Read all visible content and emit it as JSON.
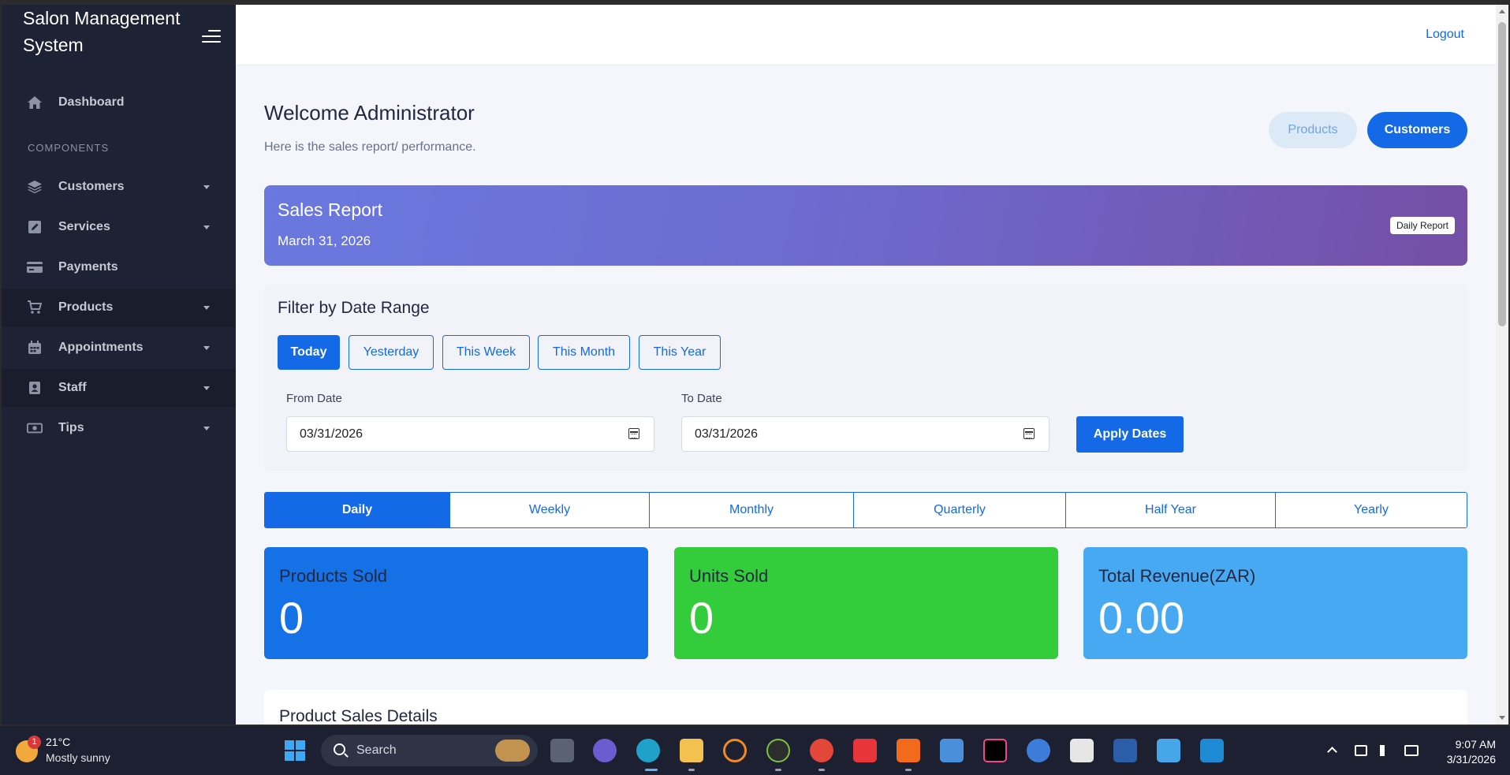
{
  "app": {
    "brand": "Salon Management System",
    "logout_label": "Logout"
  },
  "sidebar": {
    "section_label": "COMPONENTS",
    "items": [
      {
        "label": "Dashboard",
        "icon": "home-icon",
        "has_caret": false
      },
      {
        "label": "Customers",
        "icon": "layers-icon",
        "has_caret": true
      },
      {
        "label": "Services",
        "icon": "edit-icon",
        "has_caret": true
      },
      {
        "label": "Payments",
        "icon": "credit-card-icon",
        "has_caret": false
      },
      {
        "label": "Products",
        "icon": "cart-icon",
        "has_caret": true,
        "active": true
      },
      {
        "label": "Appointments",
        "icon": "calendar-icon",
        "has_caret": true
      },
      {
        "label": "Staff",
        "icon": "id-card-icon",
        "has_caret": true,
        "active": true
      },
      {
        "label": "Tips",
        "icon": "money-icon",
        "has_caret": true
      }
    ]
  },
  "header": {
    "title": "Welcome Administrator",
    "subtitle": "Here is the sales report/ performance.",
    "products_button": "Products",
    "customers_button": "Customers"
  },
  "banner": {
    "title": "Sales Report",
    "date": "March 31, 2026",
    "badge": "Daily Report"
  },
  "filter": {
    "title": "Filter by Date Range",
    "ranges": [
      {
        "label": "Today",
        "active": true
      },
      {
        "label": "Yesterday",
        "active": false
      },
      {
        "label": "This Week",
        "active": false
      },
      {
        "label": "This Month",
        "active": false
      },
      {
        "label": "This Year",
        "active": false
      }
    ],
    "from_label": "From Date",
    "from_value": "03/31/2026",
    "to_label": "To Date",
    "to_value": "03/31/2026",
    "apply_label": "Apply Dates"
  },
  "periods": [
    {
      "label": "Daily",
      "active": true
    },
    {
      "label": "Weekly",
      "active": false
    },
    {
      "label": "Monthly",
      "active": false
    },
    {
      "label": "Quarterly",
      "active": false
    },
    {
      "label": "Half Year",
      "active": false
    },
    {
      "label": "Yearly",
      "active": false
    }
  ],
  "stats": [
    {
      "title": "Products Sold",
      "value": "0",
      "color": "#1571e6"
    },
    {
      "title": "Units Sold",
      "value": "0",
      "color": "#33cc3a"
    },
    {
      "title": "Total Revenue(ZAR)",
      "value": "0.00",
      "color": "#47a9f2"
    }
  ],
  "details": {
    "title": "Product Sales Details"
  },
  "taskbar": {
    "weather_temp": "21°C",
    "weather_desc": "Mostly sunny",
    "weather_badge": "1",
    "search_label": "Search",
    "clock_time": "9:07 AM",
    "clock_date": "3/31/2026"
  },
  "colors": {
    "accent": "#1469e6",
    "sidebar_bg": "#1d2234"
  }
}
